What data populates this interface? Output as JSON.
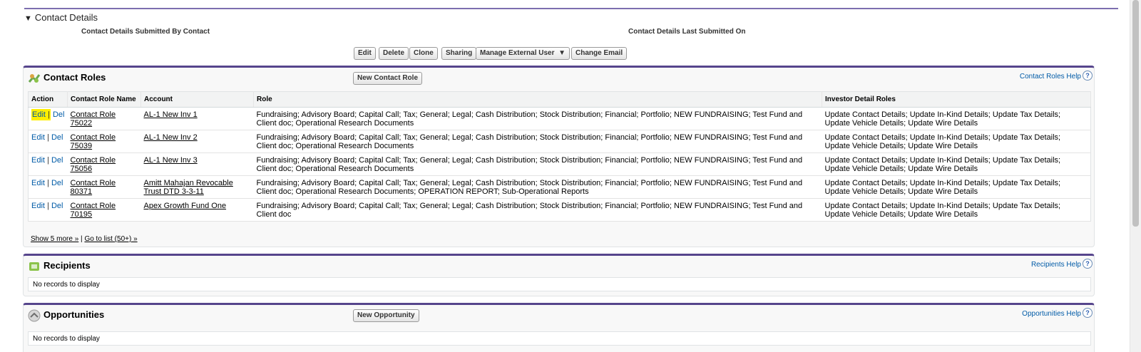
{
  "contact_details": {
    "title": "Contact Details",
    "submitted_by_label": "Contact Details Submitted By Contact",
    "last_submitted_label": "Contact Details Last Submitted On",
    "buttons": {
      "edit": "Edit",
      "delete": "Delete",
      "clone": "Clone",
      "sharing": "Sharing",
      "manage_external_user": "Manage External User",
      "change_email": "Change Email"
    }
  },
  "contact_roles": {
    "title": "Contact Roles",
    "new_button": "New Contact Role",
    "help": "Contact Roles Help",
    "columns": [
      "Action",
      "Contact Role Name",
      "Account",
      "Role",
      "Investor Detail Roles"
    ],
    "action_edit": "Edit",
    "action_del": "Del",
    "action_sep": "|",
    "rows": [
      {
        "name": "Contact Role 75022",
        "account": "AL-1 New Inv 1",
        "role": "Fundraising; Advisory Board; Capital Call; Tax; General; Legal; Cash Distribution; Stock Distribution; Financial; Portfolio; NEW FUNDRAISING; Test Fund and Client doc; Operational Research Documents",
        "investor_roles": "Update Contact Details; Update In-Kind Details; Update Tax Details; Update Vehicle Details; Update Wire Details"
      },
      {
        "name": "Contact Role 75039",
        "account": "AL-1 New Inv 2",
        "role": "Fundraising; Advisory Board; Capital Call; Tax; General; Legal; Cash Distribution; Stock Distribution; Financial; Portfolio; NEW FUNDRAISING; Test Fund and Client doc; Operational Research Documents",
        "investor_roles": "Update Contact Details; Update In-Kind Details; Update Tax Details; Update Vehicle Details; Update Wire Details"
      },
      {
        "name": "Contact Role 75056",
        "account": "AL-1 New Inv 3",
        "role": "Fundraising; Advisory Board; Capital Call; Tax; General; Legal; Cash Distribution; Stock Distribution; Financial; Portfolio; NEW FUNDRAISING; Test Fund and Client doc; Operational Research Documents",
        "investor_roles": "Update Contact Details; Update In-Kind Details; Update Tax Details; Update Vehicle Details; Update Wire Details"
      },
      {
        "name": "Contact Role 80371",
        "account": "Amitt Mahajan Revocable Trust DTD 3-3-11",
        "role": "Fundraising; Advisory Board; Capital Call; Tax; General; Legal; Cash Distribution; Stock Distribution; Financial; Portfolio; NEW FUNDRAISING; Test Fund and Client doc; Operational Research Documents; OPERATION REPORT; Sub-Operational Reports",
        "investor_roles": "Update Contact Details; Update In-Kind Details; Update Tax Details; Update Vehicle Details; Update Wire Details"
      },
      {
        "name": "Contact Role 70195",
        "account": "Apex Growth Fund One",
        "role": "Fundraising; Advisory Board; Capital Call; Tax; General; Legal; Cash Distribution; Stock Distribution; Financial; Portfolio; NEW FUNDRAISING; Test Fund and Client doc",
        "investor_roles": "Update Contact Details; Update In-Kind Details; Update Tax Details; Update Vehicle Details; Update Wire Details"
      }
    ],
    "show_more": "Show 5 more »",
    "footer_sep": "|",
    "go_to_list": "Go to list (50+) »"
  },
  "recipients": {
    "title": "Recipients",
    "help": "Recipients Help",
    "empty": "No records to display"
  },
  "opportunities": {
    "title": "Opportunities",
    "new_button": "New Opportunity",
    "help": "Opportunities Help",
    "empty": "No records to display"
  },
  "help_icon": "?",
  "toggle_icon": "▼",
  "dropdown_icon": "▼",
  "colors": {
    "panel_border": "#56458c",
    "link": "#015ba7",
    "highlight": "#ffee00"
  }
}
